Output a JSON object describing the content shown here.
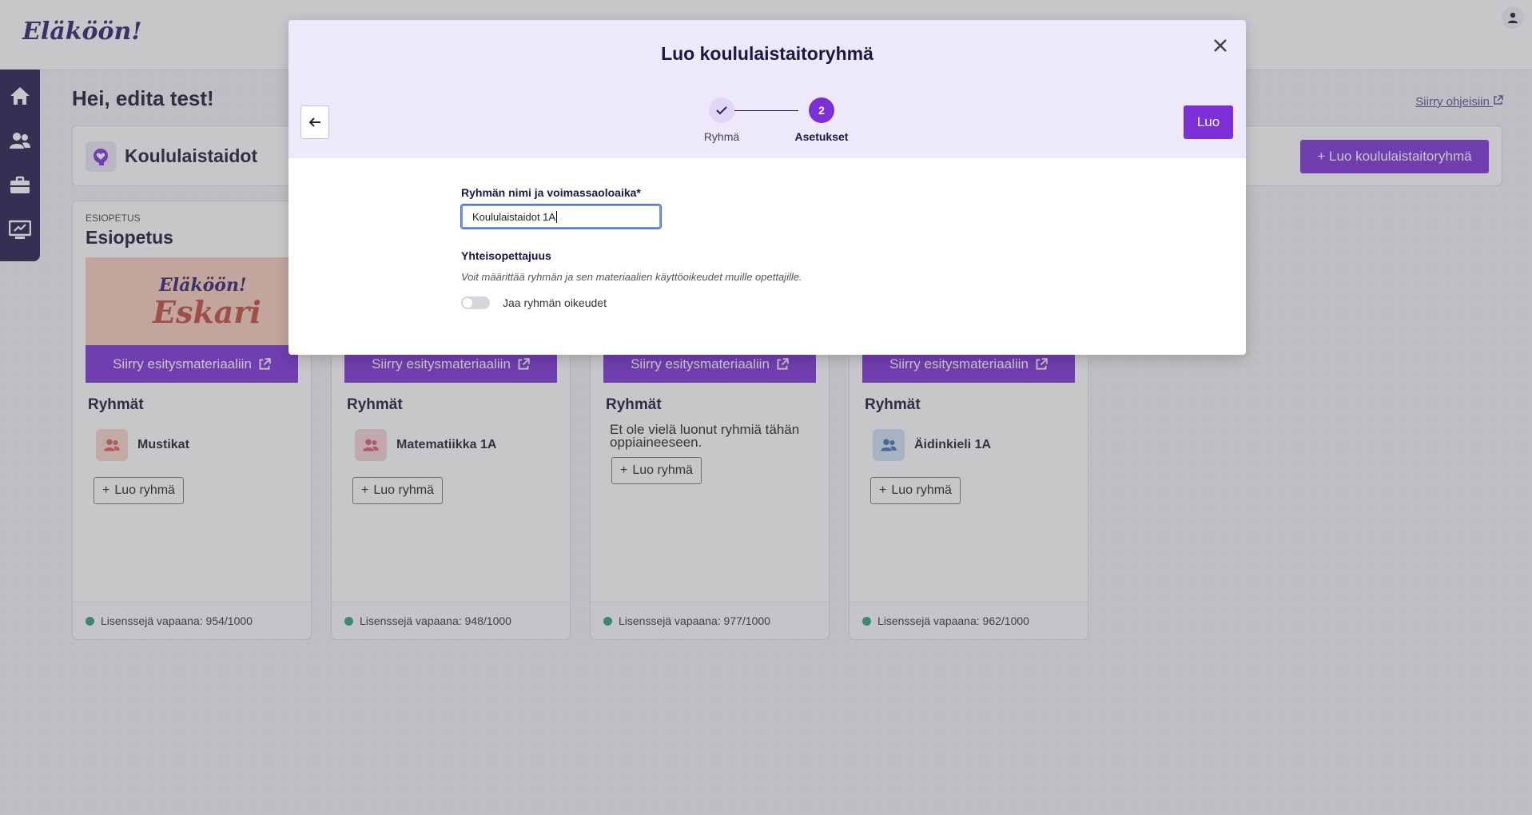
{
  "app": {
    "logo": "Eläköön!"
  },
  "greeting": "Hei, edita test!",
  "help_link": "Siirry ohjeisiin",
  "section": {
    "title": "Koululaistaidot",
    "create_button": "+ Luo koululaistaitoryhmä"
  },
  "cards": [
    {
      "eyebrow": "ESIOPETUS",
      "title": "Esiopetus",
      "banner_line1": "Eläköön!",
      "banner_line2": "Eskari",
      "material_button": "Siirry esitysmateriaaliin",
      "groups_heading": "Ryhmät",
      "group": "Mustikat",
      "create_group": "Luo ryhmä",
      "licenses": "Lisenssejä vapaana: 954/1000",
      "group_color": "#f7d4cc"
    },
    {
      "material_button": "Siirry esitysmateriaaliin",
      "groups_heading": "Ryhmät",
      "group": "Matematiikka 1A",
      "create_group": "Luo ryhmä",
      "licenses": "Lisenssejä vapaana: 948/1000",
      "group_color": "#f6d0d8"
    },
    {
      "material_button": "Siirry esitysmateriaaliin",
      "groups_heading": "Ryhmät",
      "empty_text": "Et ole vielä luonut ryhmiä tähän oppiaineeseen.",
      "create_group": "Luo ryhmä",
      "licenses": "Lisenssejä vapaana: 977/1000"
    },
    {
      "material_button": "Siirry esitysmateriaaliin",
      "groups_heading": "Ryhmät",
      "group": "Äidinkieli 1A",
      "create_group": "Luo ryhmä",
      "licenses": "Lisenssejä vapaana: 962/1000",
      "group_color": "#cfe0f5"
    }
  ],
  "modal": {
    "title": "Luo koululaistaitoryhmä",
    "steps": [
      {
        "label": "Ryhmä",
        "state": "done"
      },
      {
        "label": "Asetukset",
        "number": "2",
        "state": "active"
      }
    ],
    "create_button": "Luo",
    "name_label": "Ryhmän nimi ja voimassaoloaika*",
    "name_value": "Koululaistaidot 1A",
    "share_heading": "Yhteisopettajuus",
    "share_description": "Voit määrittää ryhmän ja sen materiaalien käyttöoikeudet muille opettajille.",
    "share_toggle_label": "Jaa ryhmän oikeudet",
    "share_toggle_on": false
  },
  "colors": {
    "accent": "#7c2fd6",
    "sidebar": "#211a4c",
    "license_dot": "#2aa37a",
    "modal_header": "#ede9fa"
  }
}
